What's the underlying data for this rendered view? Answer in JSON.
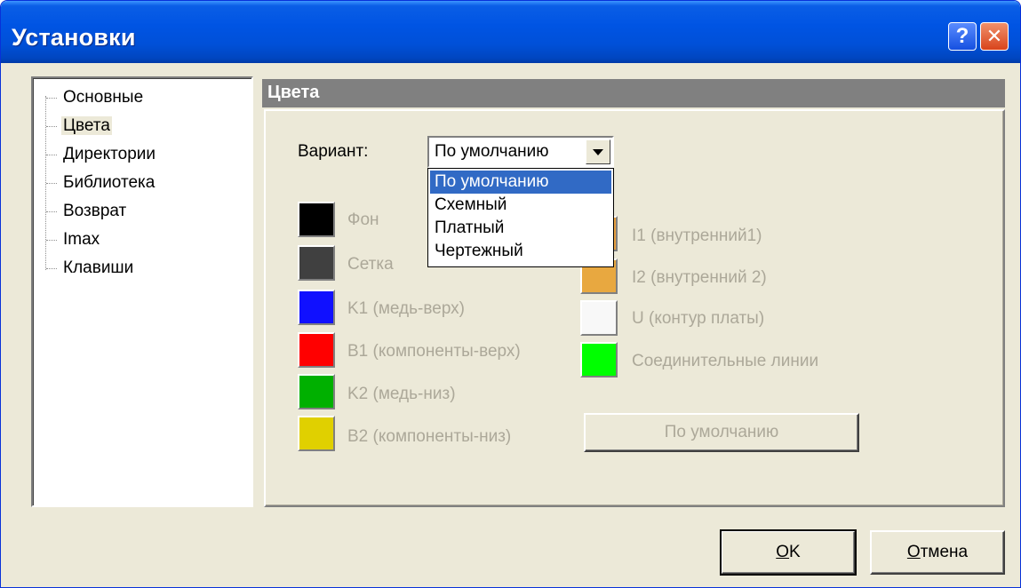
{
  "window": {
    "title": "Установки",
    "help_glyph": "?",
    "close_glyph": "✕"
  },
  "tree": {
    "items": [
      {
        "label": "Основные",
        "selected": false
      },
      {
        "label": "Цвета",
        "selected": true
      },
      {
        "label": "Директории",
        "selected": false
      },
      {
        "label": "Библиотека",
        "selected": false
      },
      {
        "label": "Возврат",
        "selected": false
      },
      {
        "label": "Imax",
        "selected": false
      },
      {
        "label": "Клавиши",
        "selected": false
      }
    ]
  },
  "section": {
    "title": "Цвета"
  },
  "variant": {
    "label": "Вариант:",
    "value": "По умолчанию",
    "options": [
      "По умолчанию",
      "Схемный",
      "Платный",
      "Чертежный"
    ]
  },
  "colors_left": [
    {
      "label": "Фон",
      "color": "#000000"
    },
    {
      "label": "Сетка",
      "color": "#404040"
    },
    {
      "label": "K1 (медь-верх)",
      "color": "#1010ff"
    },
    {
      "label": "B1 (компоненты-верх)",
      "color": "#ff0000"
    },
    {
      "label": "K2 (медь-низ)",
      "color": "#00b000"
    },
    {
      "label": "B2 (компоненты-низ)",
      "color": "#e0d000"
    }
  ],
  "colors_right": [
    {
      "label": "I1 (внутренний1)",
      "color": "#e8a040"
    },
    {
      "label": "I2 (внутренний 2)",
      "color": "#e8a840"
    },
    {
      "label": "U (контур платы)",
      "color": "#f8f8f8"
    },
    {
      "label": "Соединительные линии",
      "color": "#00ff00"
    }
  ],
  "buttons": {
    "default_colors": "По умолчанию",
    "ok": "OK",
    "cancel": "Отмена"
  }
}
